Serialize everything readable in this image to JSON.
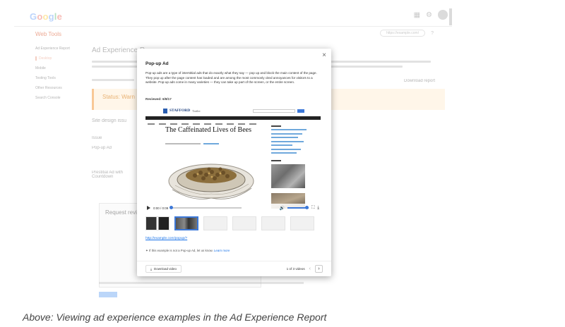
{
  "background": {
    "logo": "Google",
    "tool_title": "Web Tools",
    "site_selector": "https://example.com/",
    "nav_items": [
      "Ad Experience Report",
      "Desktop",
      "Mobile",
      "Testing Tools",
      "Other Resources",
      "Search Console"
    ],
    "page_heading": "Ad Experience R",
    "status_label": "Status: Warn",
    "section_label": "Site design issu",
    "row_labels": [
      "Issue",
      "Pop-up Ad",
      "Prestitial Ad with Countdown"
    ],
    "request_review_heading": "Request review",
    "download_report": "Download report"
  },
  "modal": {
    "title": "Pop-up Ad",
    "description": "Pop-up ads are a type of interstitial ads that do exactly what they say — pop up and block the main content of the page. They pop up after the page content has loaded and are among the most commonly cited annoyances for visitors to a website. Pop-up ads come in many varieties — they can take up part of the screen, or the entire screen.",
    "reviewed": "Reviewed: 6/8/17",
    "video": {
      "site_name": "STAFFORD",
      "site_name_sub": "Tattler",
      "article_title": "The Caffeinated Lives of Bees",
      "time": "0:00 / 0:09",
      "progress": 0.0
    },
    "example_link": "http://example.com/popup/?",
    "notice_text": "If this example is not a Pop-up Ad, let us know.",
    "learn_more": "Learn more",
    "download_label": "Download video",
    "pager_text": "1 of 3 videos"
  },
  "caption": "Above: Viewing ad experience examples in the Ad Experience Report"
}
